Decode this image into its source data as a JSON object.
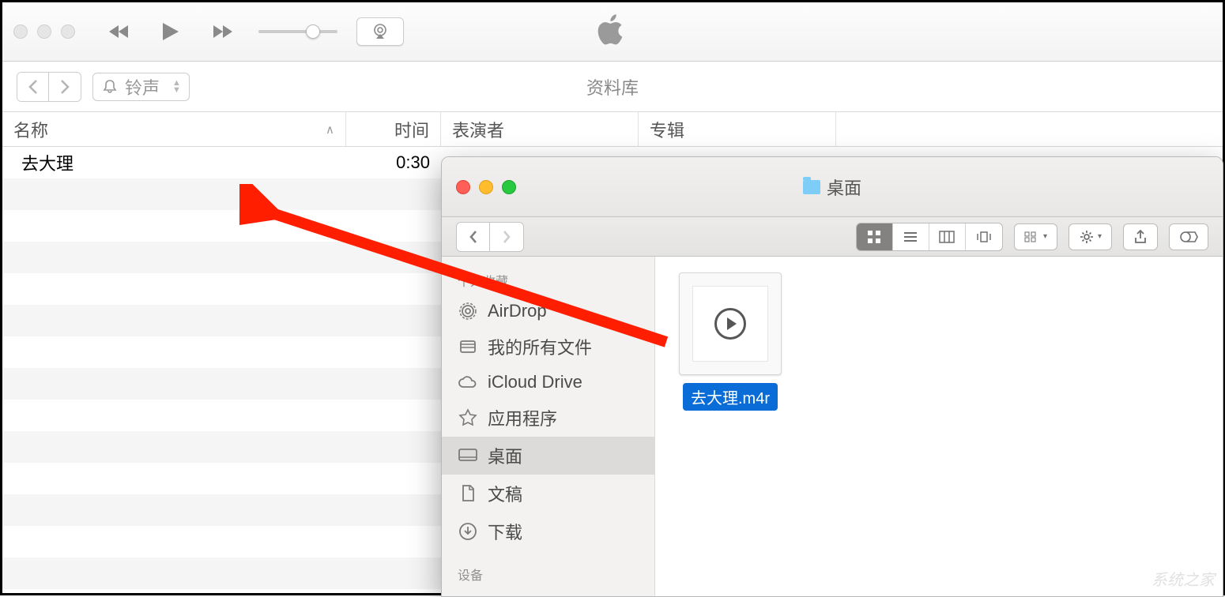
{
  "itunes": {
    "library_dropdown": "铃声",
    "library_title": "资料库",
    "columns": {
      "name": "名称",
      "time": "时间",
      "artist": "表演者",
      "album": "专辑"
    },
    "tracks": [
      {
        "name": "去大理",
        "time": "0:30"
      }
    ]
  },
  "finder": {
    "title": "桌面",
    "sidebar": {
      "section": "个人收藏",
      "items": [
        {
          "label": "AirDrop",
          "icon": "airdrop"
        },
        {
          "label": "我的所有文件",
          "icon": "allfiles"
        },
        {
          "label": "iCloud Drive",
          "icon": "icloud"
        },
        {
          "label": "应用程序",
          "icon": "apps"
        },
        {
          "label": "桌面",
          "icon": "desktop",
          "selected": true
        },
        {
          "label": "文稿",
          "icon": "documents"
        },
        {
          "label": "下载",
          "icon": "downloads"
        }
      ],
      "section2": "设备"
    },
    "file": {
      "name": "去大理.m4r"
    }
  },
  "watermark": "系统之家"
}
